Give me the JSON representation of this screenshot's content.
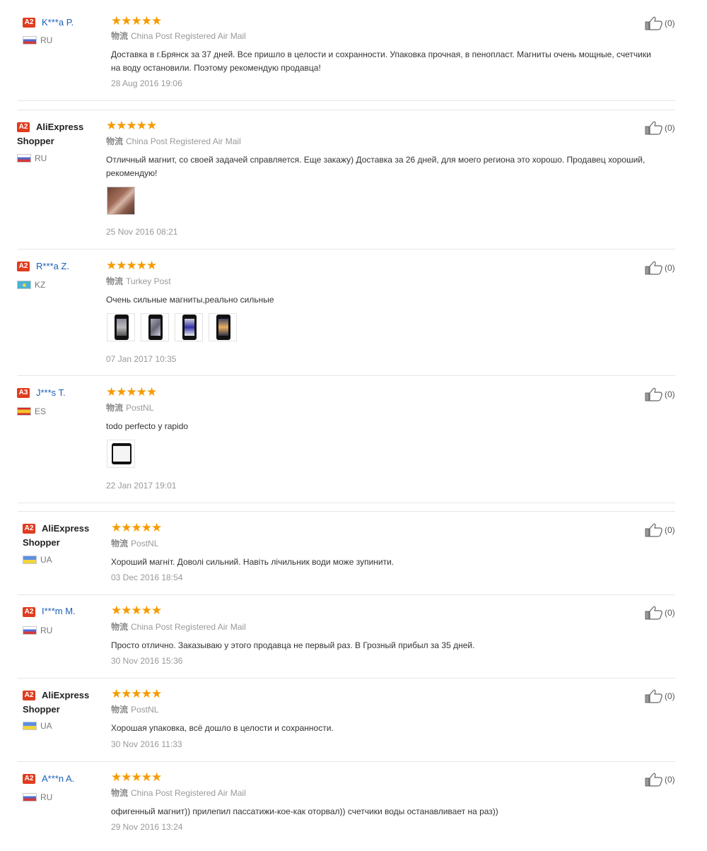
{
  "shipping_label": "物流",
  "reviews": [
    {
      "level": "A2",
      "user": "K***a P.",
      "country": "RU",
      "shipping": "China Post Registered Air Mail",
      "text": "Доставка в г.Брянск за 37 дней. Все пришло в целости и сохранности. Упаковка прочная, в пенопласт. Магниты очень мощные, счетчики на воду остановили. Поэтому рекомендую продавца!",
      "date": "28 Aug 2016 19:06",
      "likes": "(0)",
      "rating": 5
    },
    {
      "level": "A2",
      "user": "AliExpress Shopper",
      "country": "RU",
      "shipping": "China Post Registered Air Mail",
      "text": "Отличный магнит, со своей задачей справляется. Еще закажу) Доставка за 26 дней, для моего региона это хорошо. Продавец хороший, рекомендую!",
      "date": "25 Nov 2016 08:21",
      "likes": "(0)",
      "rating": 5
    },
    {
      "level": "A2",
      "user": "R***a Z.",
      "country": "KZ",
      "shipping": "Turkey Post",
      "text": "Очень сильные магниты,реально сильные",
      "date": "07 Jan 2017 10:35",
      "likes": "(0)",
      "rating": 5
    },
    {
      "level": "A3",
      "user": "J***s T.",
      "country": "ES",
      "shipping": "PostNL",
      "text": "todo perfecto y rapido",
      "date": "22 Jan 2017 19:01",
      "likes": "(0)",
      "rating": 5
    },
    {
      "level": "A2",
      "user": "AliExpress Shopper",
      "country": "UA",
      "shipping": "PostNL",
      "text": "Хороший магніт. Доволі сильний. Навіть лічильник води може зупинити.",
      "date": "03 Dec 2016 18:54",
      "likes": "(0)",
      "rating": 5
    },
    {
      "level": "A2",
      "user": "I***m M.",
      "country": "RU",
      "shipping": "China Post Registered Air Mail",
      "text": "Просто отлично. Заказываю у этого продавца не первый раз. В Грозный прибыл за 35 дней.",
      "date": "30 Nov 2016 15:36",
      "likes": "(0)",
      "rating": 5
    },
    {
      "level": "A2",
      "user": "AliExpress Shopper",
      "country": "UA",
      "shipping": "PostNL",
      "text": "Хорошая упаковка, всё дошло в целости и сохранности.",
      "date": "30 Nov 2016 11:33",
      "likes": "(0)",
      "rating": 5
    },
    {
      "level": "A2",
      "user": "A***n A.",
      "country": "RU",
      "shipping": "China Post Registered Air Mail",
      "text": "офигенный магнит)) прилепил пассатижи-кое-как оторвал)) счетчики воды останавливает на раз))",
      "date": "29 Nov 2016 13:24",
      "likes": "(0)",
      "rating": 5
    }
  ]
}
